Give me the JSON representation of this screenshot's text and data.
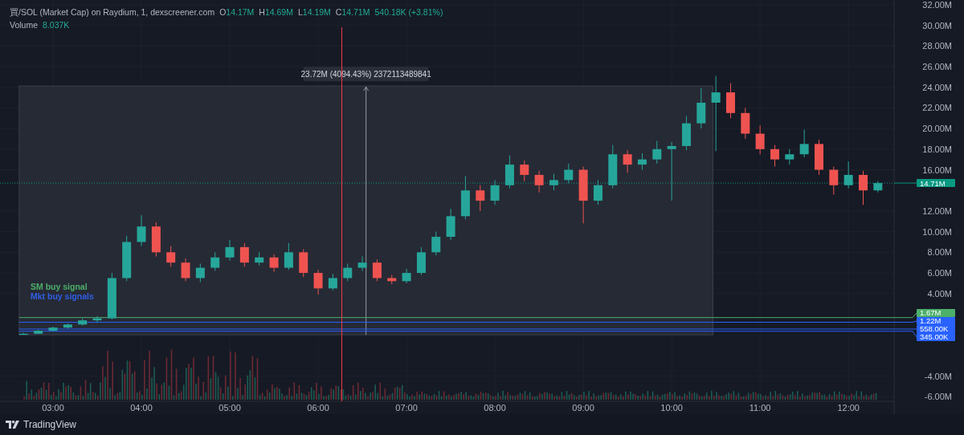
{
  "legend": {
    "symbol": "買/SOL (Market Cap) on Raydium, 1, dexscreener.com",
    "ohlc": [
      {
        "key": "O",
        "value": "14.17M"
      },
      {
        "key": "H",
        "value": "14.69M"
      },
      {
        "key": "L",
        "value": "14.19M"
      },
      {
        "key": "C",
        "value": "14.71M"
      }
    ],
    "change": "540.18K (+3.81%)",
    "volume_label": "Volume",
    "volume_value": "8.037K"
  },
  "signals": [
    {
      "label": "SM buy signal",
      "color": "#4caf6a"
    },
    {
      "label": "Mkt buy signals",
      "color": "#2f5fe6"
    }
  ],
  "chart_data": {
    "type": "candlestick",
    "grid": true,
    "x": [
      160,
      170,
      180,
      190,
      200,
      210,
      220,
      230,
      240,
      250,
      260,
      270,
      280,
      290,
      300,
      310,
      320,
      330,
      340,
      350,
      360,
      370,
      380,
      390,
      400,
      410,
      420,
      430,
      440,
      450,
      460,
      470,
      480,
      490,
      500,
      510,
      520,
      530,
      540,
      550,
      560,
      570,
      580,
      590,
      600,
      610,
      620,
      630,
      640,
      650,
      660,
      670,
      680,
      690,
      700,
      710,
      720,
      730,
      740
    ],
    "ohlc": [
      [
        0.0,
        0.2,
        0.0,
        0.1
      ],
      [
        0.1,
        0.5,
        0.1,
        0.4
      ],
      [
        0.4,
        0.8,
        0.3,
        0.7
      ],
      [
        0.7,
        1.1,
        0.6,
        1.0
      ],
      [
        1.0,
        1.6,
        0.9,
        1.4
      ],
      [
        1.4,
        1.8,
        1.2,
        1.6
      ],
      [
        1.6,
        6.0,
        1.5,
        5.5
      ],
      [
        5.5,
        9.6,
        5.2,
        9.0
      ],
      [
        9.0,
        11.6,
        8.6,
        10.5
      ],
      [
        10.5,
        10.9,
        7.6,
        8.0
      ],
      [
        8.0,
        8.6,
        6.6,
        7.0
      ],
      [
        7.0,
        7.4,
        5.2,
        5.5
      ],
      [
        5.5,
        6.9,
        5.1,
        6.5
      ],
      [
        6.5,
        8.0,
        6.2,
        7.5
      ],
      [
        7.5,
        9.2,
        7.2,
        8.5
      ],
      [
        8.5,
        8.9,
        6.6,
        7.0
      ],
      [
        7.0,
        8.0,
        6.7,
        7.5
      ],
      [
        7.5,
        7.8,
        6.1,
        6.5
      ],
      [
        6.5,
        8.9,
        6.3,
        8.0
      ],
      [
        8.0,
        8.3,
        5.6,
        6.0
      ],
      [
        6.0,
        6.3,
        3.9,
        4.5
      ],
      [
        4.5,
        5.9,
        4.3,
        5.5
      ],
      [
        5.5,
        6.9,
        5.2,
        6.5
      ],
      [
        6.5,
        7.6,
        6.2,
        7.0
      ],
      [
        7.0,
        7.3,
        5.2,
        5.5
      ],
      [
        5.5,
        5.8,
        4.9,
        5.2
      ],
      [
        5.2,
        6.4,
        5.0,
        6.0
      ],
      [
        6.0,
        8.5,
        5.8,
        8.0
      ],
      [
        8.0,
        10.0,
        7.7,
        9.5
      ],
      [
        9.5,
        12.2,
        9.2,
        11.5
      ],
      [
        11.5,
        15.4,
        11.2,
        14.0
      ],
      [
        14.0,
        14.5,
        12.0,
        13.0
      ],
      [
        13.0,
        15.0,
        12.6,
        14.5
      ],
      [
        14.5,
        17.4,
        14.2,
        16.5
      ],
      [
        16.5,
        16.9,
        14.9,
        15.5
      ],
      [
        15.5,
        15.9,
        13.8,
        14.5
      ],
      [
        14.5,
        15.6,
        14.0,
        15.0
      ],
      [
        15.0,
        16.6,
        14.7,
        16.0
      ],
      [
        16.0,
        16.3,
        10.8,
        13.0
      ],
      [
        13.0,
        15.0,
        12.6,
        14.5
      ],
      [
        14.5,
        18.4,
        14.2,
        17.5
      ],
      [
        17.5,
        17.9,
        15.7,
        16.5
      ],
      [
        16.5,
        17.6,
        16.0,
        17.0
      ],
      [
        17.0,
        18.8,
        16.6,
        18.0
      ],
      [
        18.0,
        18.7,
        13.0,
        18.3
      ],
      [
        18.3,
        21.2,
        17.9,
        20.5
      ],
      [
        20.5,
        23.9,
        20.0,
        22.5
      ],
      [
        22.5,
        25.1,
        17.8,
        23.5
      ],
      [
        23.5,
        24.4,
        21.0,
        21.5
      ],
      [
        21.5,
        22.0,
        19.0,
        19.5
      ],
      [
        19.5,
        20.3,
        17.5,
        18.0
      ],
      [
        18.0,
        18.4,
        16.3,
        17.0
      ],
      [
        17.0,
        18.0,
        16.5,
        17.5
      ],
      [
        17.5,
        19.9,
        17.2,
        18.5
      ],
      [
        18.5,
        18.9,
        15.5,
        16.0
      ],
      [
        16.0,
        16.3,
        13.6,
        14.5
      ],
      [
        14.5,
        16.8,
        14.2,
        15.5
      ],
      [
        15.5,
        15.9,
        12.6,
        14.0
      ],
      [
        14.0,
        14.9,
        13.8,
        14.71
      ]
    ],
    "xlim": [
      144,
      751
    ],
    "ylim": [
      -6.6,
      32.3
    ],
    "yticks": [
      {
        "value": 32,
        "label": "32.00M"
      },
      {
        "value": 30,
        "label": "30.00M"
      },
      {
        "value": 28,
        "label": "28.00M"
      },
      {
        "value": 26,
        "label": "26.00M"
      },
      {
        "value": 24,
        "label": "24.00M"
      },
      {
        "value": 22,
        "label": "22.00M"
      },
      {
        "value": 20,
        "label": "20.00M"
      },
      {
        "value": 18,
        "label": "18.00M"
      },
      {
        "value": 16,
        "label": "16.00M"
      },
      {
        "value": 12,
        "label": "12.00M"
      },
      {
        "value": 10,
        "label": "10.00M"
      },
      {
        "value": 8,
        "label": "8.00M"
      },
      {
        "value": 6,
        "label": "6.00M"
      },
      {
        "value": 4,
        "label": "4.00M"
      },
      {
        "value": -4,
        "label": "-4.00M"
      },
      {
        "value": -6,
        "label": "-6.00M"
      }
    ],
    "xticks": [
      {
        "value": 180,
        "label": "03:00"
      },
      {
        "value": 240,
        "label": "04:00"
      },
      {
        "value": 300,
        "label": "05:00"
      },
      {
        "value": 360,
        "label": "06:00"
      },
      {
        "value": 420,
        "label": "07:00"
      },
      {
        "value": 480,
        "label": "08:00"
      },
      {
        "value": 540,
        "label": "09:00"
      },
      {
        "value": 600,
        "label": "10:00"
      },
      {
        "value": 660,
        "label": "11:00"
      },
      {
        "value": 720,
        "label": "12:00"
      }
    ],
    "ref_lines": [
      {
        "axis": "y",
        "value": 14.71,
        "label": "14.71M",
        "color": "#089981"
      },
      {
        "axis": "y",
        "value": 1.67,
        "label": "1.67M",
        "color": "#4caf6a"
      },
      {
        "axis": "y",
        "value": 1.22,
        "label": "1.22M",
        "color": "#2962ff"
      },
      {
        "axis": "y",
        "value": 0.558,
        "label": "558.00K",
        "color": "#2962ff"
      },
      {
        "axis": "y",
        "value": 0.345,
        "label": "345.00K",
        "color": "#2962ff"
      }
    ],
    "annotations": [
      {
        "text": "23.72M (4094.43%) 2372113489841"
      }
    ]
  },
  "footer": {
    "brand": "TradingView"
  }
}
